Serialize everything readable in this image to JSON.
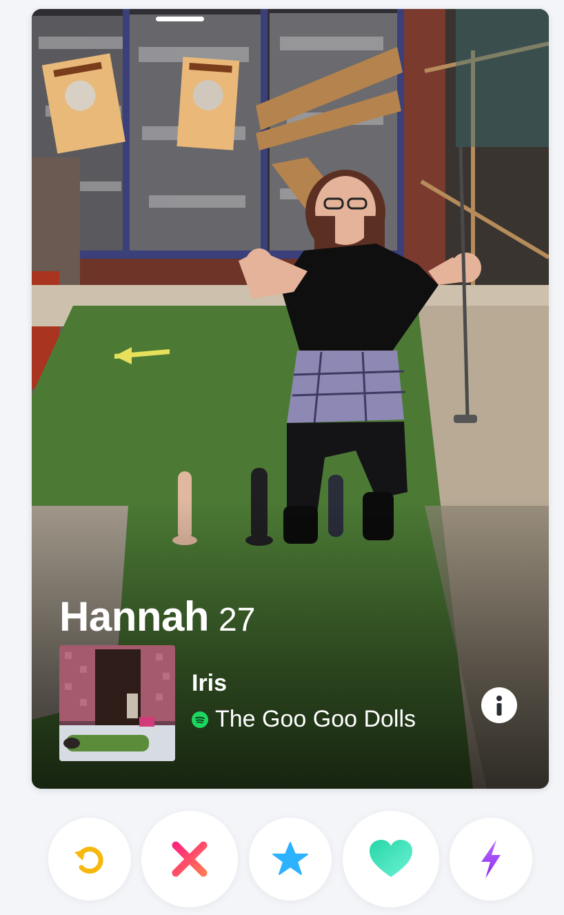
{
  "profile": {
    "name": "Hannah",
    "age": "27"
  },
  "anthem": {
    "song": "Iris",
    "artist": "The Goo Goo Dolls",
    "service_icon": "spotify-icon"
  },
  "actions": [
    {
      "name": "rewind",
      "icon": "rewind-icon",
      "color": "#f6b80c"
    },
    {
      "name": "nope",
      "icon": "x-icon",
      "color": "#fd3f6d"
    },
    {
      "name": "super-like",
      "icon": "star-icon",
      "color": "#2db2ff"
    },
    {
      "name": "like",
      "icon": "heart-icon",
      "color": "#2ee3b3"
    },
    {
      "name": "boost",
      "icon": "lightning-icon",
      "color": "#a43dff"
    }
  ],
  "colors": {
    "background": "#f3f5f9",
    "card_text": "#ffffff"
  }
}
